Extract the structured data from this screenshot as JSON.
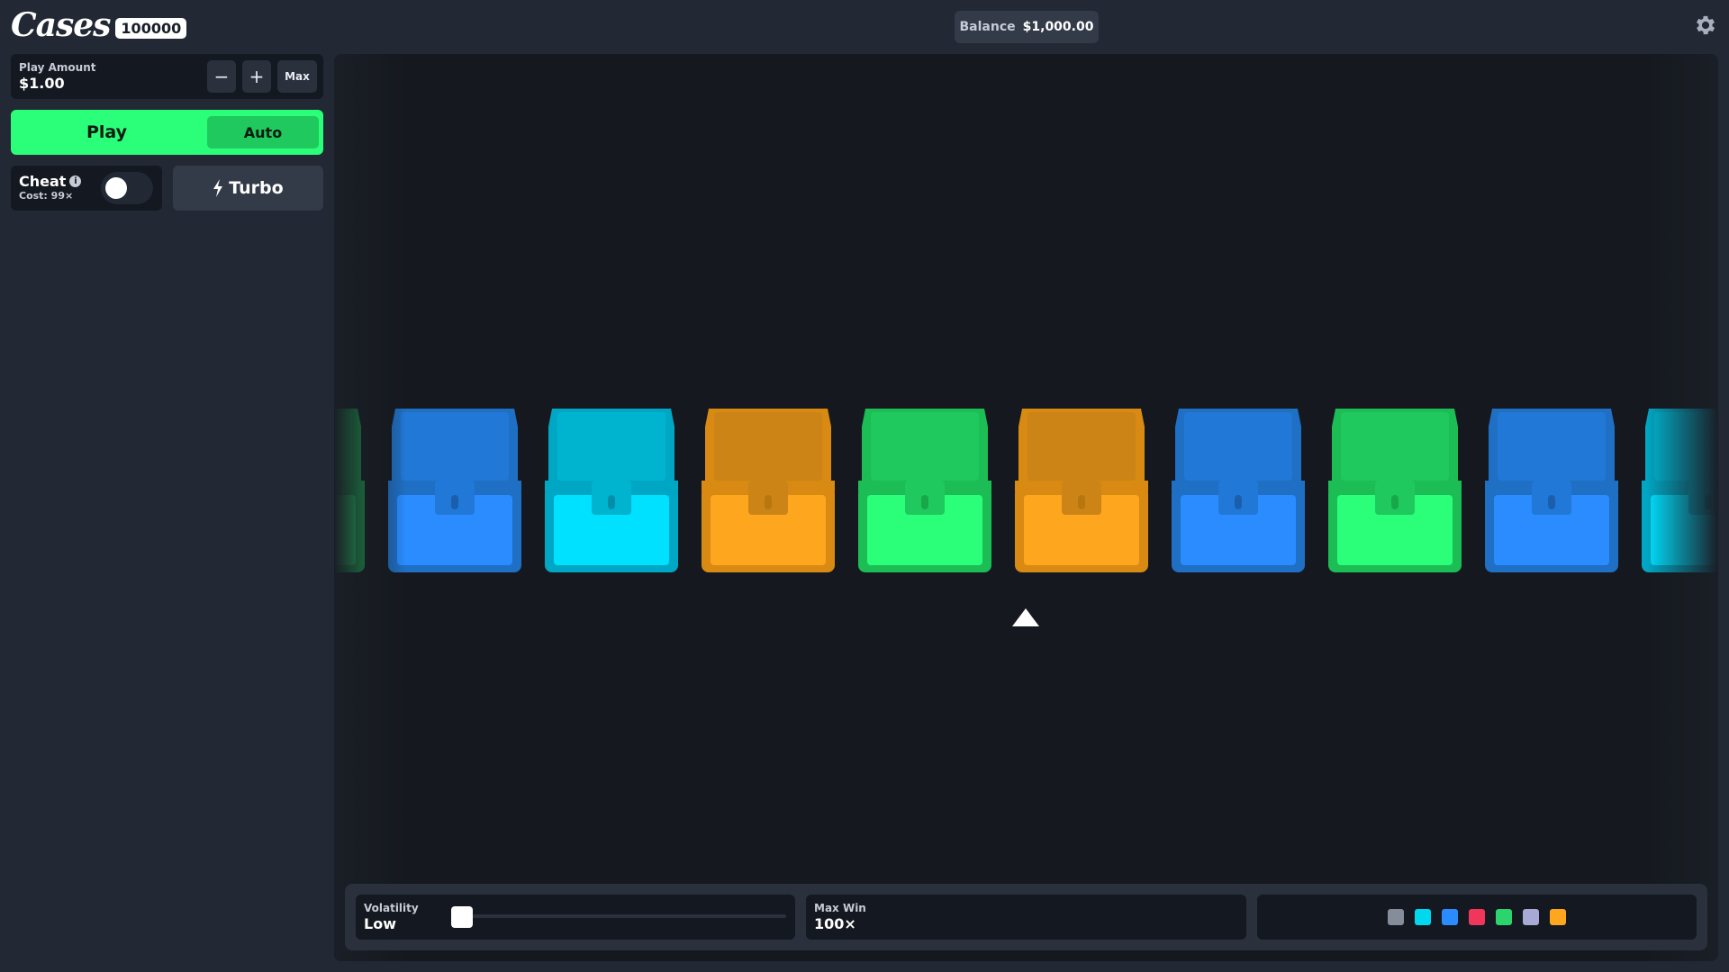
{
  "app": {
    "logo_text": "Cases",
    "logo_badge": "100000"
  },
  "balance": {
    "label": "Balance",
    "value": "$1,000.00"
  },
  "play_amount": {
    "label": "Play Amount",
    "value": "$1.00",
    "minus_label": "−",
    "plus_label": "+",
    "max_label": "Max"
  },
  "play": {
    "play_label": "Play",
    "auto_label": "Auto"
  },
  "cheat": {
    "label": "Cheat",
    "info_glyph": "i",
    "cost": "Cost: 99×",
    "enabled": false
  },
  "turbo": {
    "label": "Turbo",
    "icon": "lightning-icon"
  },
  "reel": {
    "chests": [
      {
        "color": "green"
      },
      {
        "color": "blue"
      },
      {
        "color": "cyan"
      },
      {
        "color": "orange"
      },
      {
        "color": "green"
      },
      {
        "color": "orange"
      },
      {
        "color": "blue"
      },
      {
        "color": "green"
      },
      {
        "color": "blue"
      },
      {
        "color": "cyan"
      }
    ],
    "palette": {
      "blue": {
        "lid": "#2178d6",
        "body": "#2a8cff",
        "rim": "#1f6fc4",
        "lock": "#1a5fae"
      },
      "cyan": {
        "lid": "#00b4d0",
        "body": "#00e0ff",
        "rim": "#00a7c4",
        "lock": "#008fa8"
      },
      "orange": {
        "lid": "#cc8416",
        "body": "#ffa61f",
        "rim": "#d98a12",
        "lock": "#b9760f"
      },
      "green": {
        "lid": "#1fc95d",
        "body": "#2bff7a",
        "rim": "#1cbd55",
        "lock": "#18a84a"
      }
    }
  },
  "volatility": {
    "label": "Volatility",
    "value": "Low",
    "level": 0
  },
  "max_win": {
    "label": "Max Win",
    "value": "100×"
  },
  "color_legend": [
    "#868d9a",
    "#00d8f0",
    "#2a8cff",
    "#f0365a",
    "#2bd46c",
    "#a9a9d6",
    "#ffa61f"
  ],
  "colors": {
    "accent_green": "#2bff7a",
    "background": "#222834",
    "game_background": "#15191f"
  }
}
